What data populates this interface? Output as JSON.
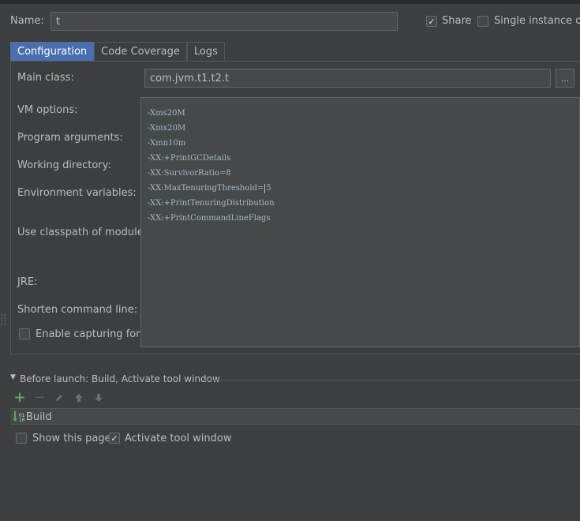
{
  "header": {
    "name_label": "Name:",
    "name_value": "t",
    "share_label": "Share",
    "share_checked": true,
    "single_instance_label": "Single instance only",
    "single_instance_checked": false
  },
  "tabs": [
    {
      "label": "Configuration",
      "active": true
    },
    {
      "label": "Code Coverage",
      "active": false
    },
    {
      "label": "Logs",
      "active": false
    }
  ],
  "config": {
    "main_class_label": "Main class:",
    "main_class_value": "com.jvm.t1.t2.t",
    "browse_label": "...",
    "vm_options_label": "VM options:",
    "program_arguments_label": "Program arguments:",
    "working_directory_label": "Working directory:",
    "environment_variables_label": "Environment variables:",
    "classpath_module_label": "Use classpath of module:",
    "jre_label": "JRE:",
    "shorten_label": "Shorten command line:",
    "enable_capturing_label": "Enable capturing form"
  },
  "vm_options": {
    "lines": [
      "-Xms20M",
      "-Xmx20M",
      "-Xmn10m",
      "-XX:+PrintGCDetails",
      "-XX:SurvivorRatio=8",
      "-XX:MaxTenuringThreshold=5",
      "-XX:+PrintTenuringDistribution",
      "-XX:+PrintCommandLineFlags"
    ],
    "caret_line_prefix": "-XX:MaxTenuringThreshold=",
    "caret_line_suffix": "5"
  },
  "before_launch": {
    "title": "Before launch: Build, Activate tool window",
    "items": [
      {
        "label": "Build",
        "icon": "build-icon"
      }
    ],
    "show_page_label": "Show this page",
    "show_page_checked": false,
    "activate_label": "Activate tool window",
    "activate_checked": true
  },
  "colors": {
    "background": "#3c3f41",
    "field": "#45494a",
    "tab_active": "#4b6eaf",
    "add_green": "#59a869"
  }
}
